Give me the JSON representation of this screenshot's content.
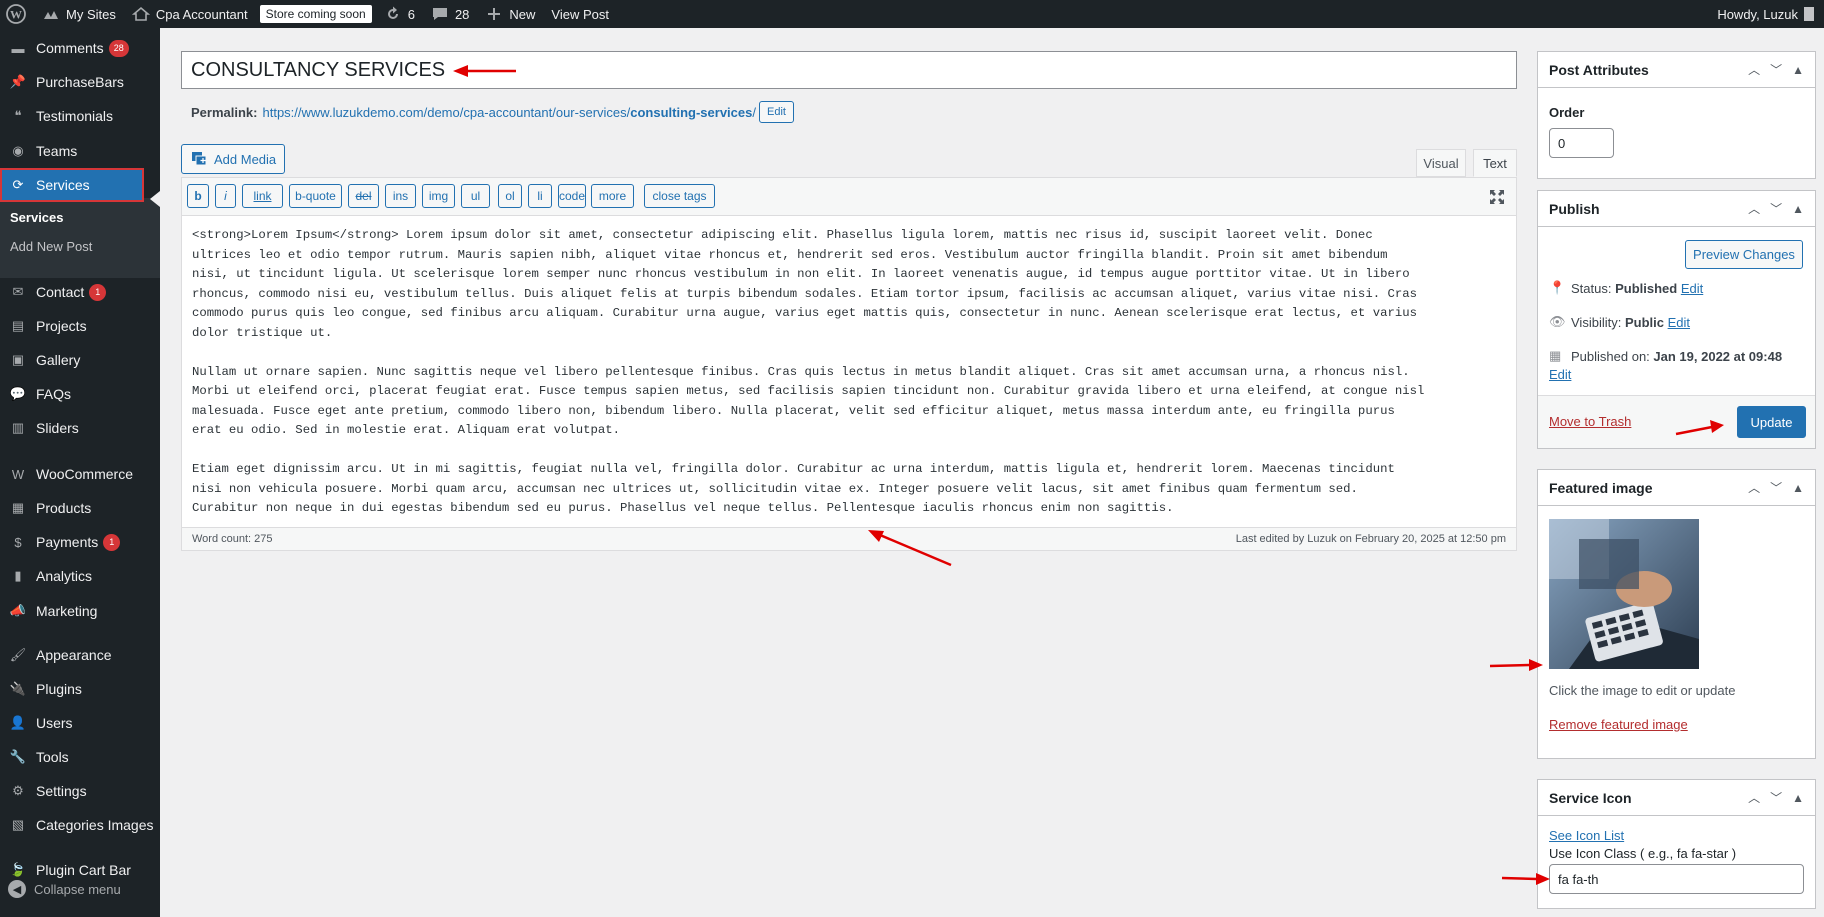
{
  "adminbar": {
    "my_sites": "My Sites",
    "site_name": "Cpa Accountant",
    "store_badge": "Store coming soon",
    "updates_count": "6",
    "comments_count": "28",
    "new_label": "New",
    "view_post": "View Post",
    "howdy": "Howdy, Luzuk"
  },
  "sidebar": {
    "items": [
      {
        "label": "Comments",
        "count": "28",
        "icon": "comments-icon"
      },
      {
        "label": "PurchaseBars",
        "icon": "pin-icon"
      },
      {
        "label": "Testimonials",
        "icon": "testimonials-icon"
      },
      {
        "label": "Teams",
        "icon": "teams-icon"
      },
      {
        "label": "Services",
        "icon": "services-icon"
      },
      {
        "label": "Contact",
        "count": "1",
        "icon": "mail-icon"
      },
      {
        "label": "Projects",
        "icon": "projects-icon"
      },
      {
        "label": "Gallery",
        "icon": "gallery-icon"
      },
      {
        "label": "FAQs",
        "icon": "faq-icon"
      },
      {
        "label": "Sliders",
        "icon": "sliders-icon"
      },
      {
        "label": "WooCommerce",
        "icon": "woo-icon"
      },
      {
        "label": "Products",
        "icon": "products-icon"
      },
      {
        "label": "Payments",
        "count": "1",
        "icon": "payments-icon"
      },
      {
        "label": "Analytics",
        "icon": "analytics-icon"
      },
      {
        "label": "Marketing",
        "icon": "marketing-icon"
      },
      {
        "label": "Appearance",
        "icon": "appearance-icon"
      },
      {
        "label": "Plugins",
        "icon": "plugins-icon"
      },
      {
        "label": "Users",
        "icon": "users-icon"
      },
      {
        "label": "Tools",
        "icon": "tools-icon"
      },
      {
        "label": "Settings",
        "icon": "settings-icon"
      },
      {
        "label": "Categories Images",
        "icon": "categories-icon"
      },
      {
        "label": "Plugin Cart Bar",
        "icon": "leaf-icon"
      }
    ],
    "submenu": {
      "current": "Services",
      "add_new": "Add New Post"
    },
    "collapse": "Collapse menu"
  },
  "editor": {
    "title": "CONSULTANCY SERVICES",
    "permalink_label": "Permalink:",
    "permalink_base": "https://www.luzukdemo.com/demo/cpa-accountant/our-services/",
    "permalink_slug": "consulting-services",
    "permalink_tail": "/",
    "permalink_edit": "Edit",
    "add_media": "Add Media",
    "tab_visual": "Visual",
    "tab_text": "Text",
    "quicktags": [
      "b",
      "i",
      "link",
      "b-quote",
      "del",
      "ins",
      "img",
      "ul",
      "ol",
      "li",
      "code",
      "more",
      "close tags"
    ],
    "content": "<strong>Lorem Ipsum</strong> Lorem ipsum dolor sit amet, consectetur adipiscing elit. Phasellus ligula lorem, mattis nec risus id, suscipit laoreet velit. Donec\nultrices leo et odio tempor rutrum. Mauris sapien nibh, aliquet vitae rhoncus et, hendrerit sed eros. Vestibulum auctor fringilla blandit. Proin sit amet bibendum\nnisi, ut tincidunt ligula. Ut scelerisque lorem semper nunc rhoncus vestibulum in non elit. In laoreet venenatis augue, id tempus augue porttitor vitae. Ut in libero\nrhoncus, commodo nisi eu, vestibulum tellus. Duis aliquet felis at turpis bibendum sodales. Etiam tortor ipsum, facilisis ac accumsan aliquet, varius vitae nisi. Cras\ncommodo purus quis leo congue, sed finibus arcu aliquam. Curabitur urna augue, varius eget mattis quis, consectetur in nunc. Aenean scelerisque erat lectus, et varius\ndolor tristique ut.\n\nNullam ut ornare sapien. Nunc sagittis neque vel libero pellentesque finibus. Cras quis lectus in metus blandit aliquet. Cras sit amet accumsan urna, a rhoncus nisl.\nMorbi ut eleifend orci, placerat feugiat erat. Fusce tempus sapien metus, sed facilisis sapien tincidunt non. Curabitur gravida libero et urna eleifend, at congue nisl\nmalesuada. Fusce eget ante pretium, commodo libero non, bibendum libero. Nulla placerat, velit sed efficitur aliquet, metus massa interdum ante, eu fringilla purus\nerat eu odio. Sed in molestie erat. Aliquam erat volutpat.\n\nEtiam eget dignissim arcu. Ut in mi sagittis, feugiat nulla vel, fringilla dolor. Curabitur ac urna interdum, mattis ligula et, hendrerit lorem. Maecenas tincidunt\nnisi non vehicula posuere. Morbi quam arcu, accumsan nec ultrices ut, sollicitudin vitae ex. Integer posuere velit lacus, sit amet finibus quam fermentum sed.\nCurabitur non neque in dui egestas bibendum sed eu purus. Phasellus vel neque tellus. Pellentesque iaculis rhoncus enim non sagittis.",
    "word_count": "Word count: 275",
    "last_edited": "Last edited by Luzuk on February 20, 2025 at 12:50 pm"
  },
  "post_attributes": {
    "title": "Post Attributes",
    "order_label": "Order",
    "order_value": "0"
  },
  "publish": {
    "title": "Publish",
    "preview": "Preview Changes",
    "status_label": "Status:",
    "status_value": "Published",
    "visibility_label": "Visibility:",
    "visibility_value": "Public",
    "published_label": "Published on:",
    "published_value": "Jan 19, 2022 at 09:48",
    "edit": "Edit",
    "trash": "Move to Trash",
    "update": "Update"
  },
  "featured_image": {
    "title": "Featured image",
    "hint": "Click the image to edit or update",
    "remove": "Remove featured image"
  },
  "service_icon": {
    "title": "Service Icon",
    "see_list": "See Icon List",
    "hint": "Use Icon Class ( e.g., fa fa-star )",
    "value": "fa fa-th"
  },
  "colors": {
    "admin_dark": "#1d2327",
    "accent": "#2271b1",
    "annotation_red": "#e00000"
  }
}
